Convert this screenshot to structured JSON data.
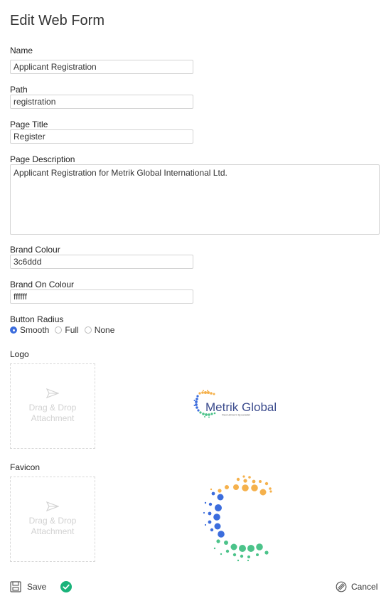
{
  "page": {
    "title": "Edit Web Form"
  },
  "form": {
    "name": {
      "label": "Name",
      "value": "Applicant Registration"
    },
    "path": {
      "label": "Path",
      "value": "registration"
    },
    "page_title": {
      "label": "Page Title",
      "value": "Register"
    },
    "page_description": {
      "label": "Page Description",
      "value": "Applicant Registration for Metrik Global International Ltd."
    },
    "brand_colour": {
      "label": "Brand Colour",
      "value": "3c6ddd"
    },
    "brand_on_colour": {
      "label": "Brand On Colour",
      "value": "ffffff"
    },
    "button_radius": {
      "label": "Button Radius",
      "selected": "Smooth",
      "options": [
        "Smooth",
        "Full",
        "None"
      ]
    },
    "logo": {
      "label": "Logo",
      "dropzone_line1": "Drag & Drop",
      "dropzone_line2": "Attachment",
      "preview_text": "Metrik Global",
      "preview_tagline": "Recruitment Specialist"
    },
    "favicon": {
      "label": "Favicon",
      "dropzone_line1": "Drag & Drop",
      "dropzone_line2": "Attachment"
    }
  },
  "footer": {
    "save_label": "Save",
    "cancel_label": "Cancel"
  },
  "colors": {
    "brand": "#3c6ddd",
    "orange": "#f5b14c",
    "green": "#4cc38a",
    "success": "#19b37a"
  }
}
